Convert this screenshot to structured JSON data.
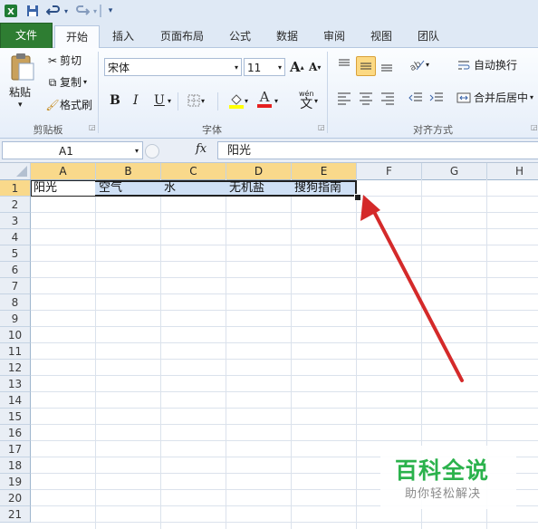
{
  "quick_access": {
    "app_icon": "excel-icon",
    "save_icon": "save-icon",
    "undo_icon": "undo-icon",
    "redo_icon": "redo-icon",
    "customize_icon": "customize-qat-icon"
  },
  "tabs": [
    {
      "label": "文件"
    },
    {
      "label": "开始"
    },
    {
      "label": "插入"
    },
    {
      "label": "页面布局"
    },
    {
      "label": "公式"
    },
    {
      "label": "数据"
    },
    {
      "label": "审阅"
    },
    {
      "label": "视图"
    },
    {
      "label": "团队"
    }
  ],
  "ribbon": {
    "clipboard": {
      "group_label": "剪贴板",
      "paste_label": "粘贴",
      "cut_label": "剪切",
      "copy_label": "复制",
      "format_painter_label": "格式刷"
    },
    "font": {
      "group_label": "字体",
      "font_name": "宋体",
      "font_size": "11",
      "grow_label": "A",
      "shrink_label": "A",
      "bold_label": "B",
      "italic_label": "I",
      "underline_label": "U",
      "font_color_label": "A",
      "phonetic_label": "wén"
    },
    "alignment": {
      "group_label": "对齐方式",
      "wrap_label": "自动换行",
      "merge_label": "合并后居中"
    }
  },
  "formula_bar": {
    "name_box": "A1",
    "fx_label": "fx",
    "formula": "阳光"
  },
  "sheet": {
    "columns": [
      "A",
      "B",
      "C",
      "D",
      "E",
      "F",
      "G",
      "H"
    ],
    "rows": [
      "1",
      "2",
      "3",
      "4",
      "5",
      "6",
      "7",
      "8",
      "9",
      "10",
      "11",
      "12",
      "13",
      "14",
      "15",
      "16",
      "17",
      "18",
      "19",
      "20",
      "21"
    ],
    "row1_cells": [
      "阳光",
      "空气",
      "水",
      "无机盐",
      "搜狗指南"
    ]
  },
  "colors": {
    "file_tab": "#2e7d32",
    "selection_fill": "#cfe0f5",
    "header_highlight": "#f9d98b",
    "arrow": "#d42a2a",
    "watermark_green": "#2bb24c"
  },
  "watermark": {
    "title": "百科全说",
    "subtitle": "助你轻松解决"
  }
}
